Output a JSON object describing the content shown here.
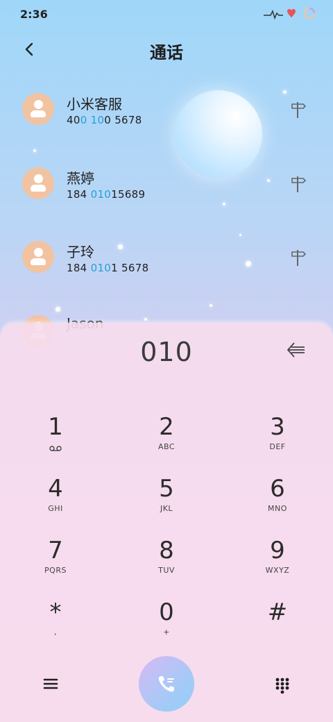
{
  "status_bar": {
    "time": "2:36"
  },
  "header": {
    "title": "通话"
  },
  "contacts": [
    {
      "name": "小米客服",
      "number_parts": [
        "40",
        "0",
        " ",
        "10",
        "0 5678"
      ]
    },
    {
      "name": "燕婷",
      "number_parts": [
        "184 ",
        "010",
        "15689",
        "",
        ""
      ]
    },
    {
      "name": "子玲",
      "number_parts": [
        "184 ",
        "010",
        "1 5678",
        "",
        ""
      ]
    },
    {
      "name": "Jason",
      "number_parts": [
        "",
        "",
        "",
        "",
        ""
      ]
    }
  ],
  "dialer": {
    "input_value": "010",
    "keys": [
      {
        "digit": "1",
        "letters": ""
      },
      {
        "digit": "2",
        "letters": "ABC"
      },
      {
        "digit": "3",
        "letters": "DEF"
      },
      {
        "digit": "4",
        "letters": "GHI"
      },
      {
        "digit": "5",
        "letters": "JKL"
      },
      {
        "digit": "6",
        "letters": "MNO"
      },
      {
        "digit": "7",
        "letters": "PQRS"
      },
      {
        "digit": "8",
        "letters": "TUV"
      },
      {
        "digit": "9",
        "letters": "WXYZ"
      },
      {
        "digit": "*",
        "letters": ","
      },
      {
        "digit": "0",
        "letters": "+"
      },
      {
        "digit": "#",
        "letters": ""
      }
    ]
  },
  "icons": {
    "back": "back-arrow-icon",
    "signpost": "signpost-icon",
    "backspace": "backspace-icon",
    "voicemail": "voicemail-icon",
    "menu": "menu-icon",
    "call": "phone-call-icon",
    "keypad": "keypad-grid-icon"
  },
  "colors": {
    "highlight": "#2a9ed8",
    "avatar": "#f2c3a1",
    "call_button_start": "#d7b8f4",
    "call_button_end": "#8fd0f7"
  }
}
